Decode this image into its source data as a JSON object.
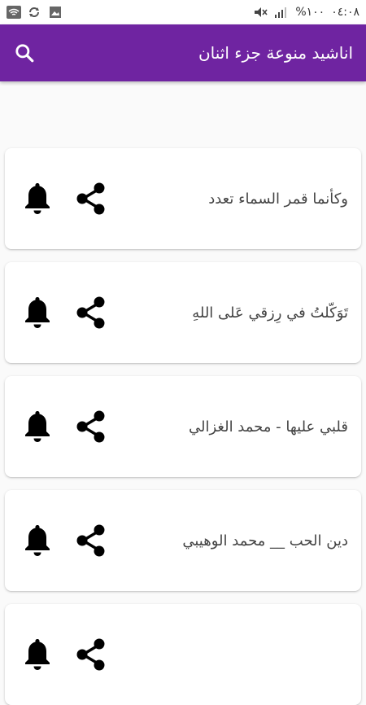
{
  "status_bar": {
    "time": "٠٤:٠٨",
    "battery": "%١٠٠"
  },
  "app_bar": {
    "title": "اناشيد منوعة جزء اثنان",
    "search_icon": "search-icon"
  },
  "items": [
    {
      "title": "وكأنما قمر السماء تعدد"
    },
    {
      "title": "تَوَكّلتُ في رِزقي عَلى اللهِ"
    },
    {
      "title": "قلبي عليها - محمد الغزالي"
    },
    {
      "title": "دين الحب __ محمد الوهيبي"
    },
    {
      "title": ""
    }
  ],
  "colors": {
    "accent": "#6f24a1",
    "card": "#ffffff",
    "background": "#fafafa"
  }
}
